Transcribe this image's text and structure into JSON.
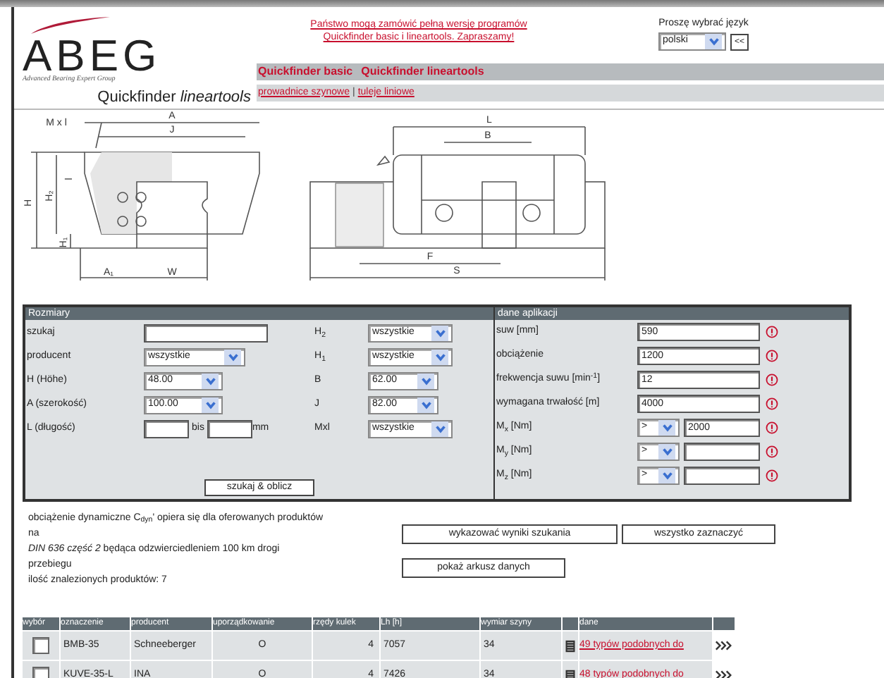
{
  "header": {
    "logo": {
      "wordmark": "ABEG",
      "tagline": "Advanced Bearing Expert Group",
      "product": "Quickfinder *lineartools*"
    },
    "promo_lines": [
      "Państwo mogą zamówić pełną wersję programów",
      "Quickfinder basic i lineartools. Zapraszamy!"
    ],
    "language": {
      "label": "Proszę wybrać język",
      "value": "polski",
      "back_button": "<<"
    },
    "nav_tabs": [
      "Quickfinder basic",
      "Quickfinder lineartools"
    ],
    "sub_links": [
      "prowadnice szynowe",
      "tuleje liniowe"
    ],
    "sub_separator": "|"
  },
  "drawing_labels": {
    "front": [
      "M x l",
      "A",
      "J",
      "H",
      "H₂",
      "H₁",
      "l",
      "A₁",
      "W"
    ],
    "side": [
      "L",
      "B",
      "F",
      "S"
    ]
  },
  "dimensions": {
    "title": "Rozmiary",
    "fields": [
      {
        "label": "szukaj",
        "kind": "text"
      },
      {
        "label": "producent",
        "kind": "select",
        "value": "wszystkie"
      },
      {
        "label": "H (Höhe)",
        "kind": "select",
        "value": "48.00"
      },
      {
        "label": "A (szerokość)",
        "kind": "select",
        "value": "100.00"
      },
      {
        "label": "L (długość)",
        "kind": "range",
        "between": "bis",
        "unit": "mm"
      }
    ],
    "fields_2": [
      {
        "label": "H$_{2}$",
        "value": "wszystkie"
      },
      {
        "label": "H$_{1}$",
        "value": "wszystkie"
      },
      {
        "label": "B",
        "value": "62.00"
      },
      {
        "label": "J",
        "value": "82.00"
      },
      {
        "label": "Mxl",
        "value": "wszystkie"
      }
    ],
    "search_button": "szukaj & oblicz"
  },
  "application": {
    "title": "dane aplikacji",
    "fields": [
      {
        "label": "suw [mm]",
        "kind": "text",
        "value": "590"
      },
      {
        "label": "obciążenie",
        "kind": "text",
        "value": "1200"
      },
      {
        "label": "frekwencja suwu [min$^{-1}$]",
        "kind": "text",
        "value": "12"
      },
      {
        "label": "wymagana trwałość [m]",
        "kind": "text",
        "value": "4000"
      },
      {
        "label": "M$_{x}$ [Nm]",
        "kind": "compare",
        "operator": ">",
        "value": "2000"
      },
      {
        "label": "M$_{y}$ [Nm]",
        "kind": "compare",
        "operator": ">"
      },
      {
        "label": "M$_{z}$ [Nm]",
        "kind": "compare",
        "operator": ">"
      }
    ]
  },
  "note": {
    "lines": [
      "obciążenie dynamiczne C$_{dyn}$' opiera się dla oferowanych produktów",
      "na",
      "*DIN 636 część 2* będąca odzwierciedleniem 100 km drogi",
      "przebiegu"
    ],
    "count": "ilość znalezionych produktów: 7"
  },
  "buttons": [
    "wykazować wyniki szukania",
    "wszystko zaznaczyć",
    "pokaż arkusz danych"
  ],
  "table": {
    "columns": [
      "wybór",
      "oznaczenie",
      "producent",
      "uporządkowanie",
      "rzędy kulek",
      "Lh [h]",
      "wymiar szyny",
      "dane"
    ],
    "rows": [
      {
        "checked": false,
        "designation": "BMB-35",
        "producer": "Schneeberger",
        "arrangement": "O",
        "ball_rows": "4",
        "lh": "7057",
        "rail": "34",
        "link": "49 typów podobnych do"
      },
      {
        "checked": false,
        "designation": "KUVE-35-L",
        "producer": "INA",
        "arrangement": "O",
        "ball_rows": "4",
        "lh": "7426",
        "rail": "34",
        "link": "48 typów podobnych do"
      }
    ]
  }
}
